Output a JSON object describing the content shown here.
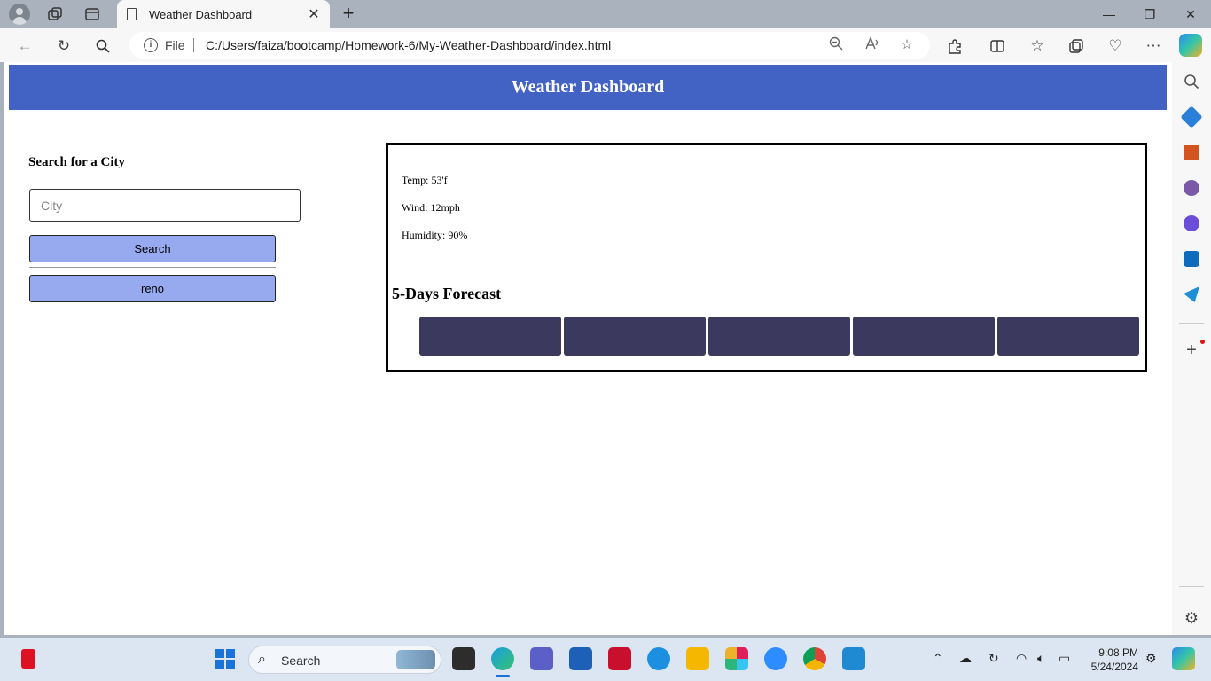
{
  "browser": {
    "tab_title": "Weather Dashboard",
    "tab_close": "✕",
    "new_tab": "+",
    "url_scheme_label": "File",
    "url": "C:/Users/faiza/bootcamp/Homework-6/My-Weather-Dashboard/index.html",
    "window_controls": [
      "—",
      "❐",
      "✕"
    ]
  },
  "page": {
    "title": "Weather Dashboard",
    "search_heading": "Search for a City",
    "city_placeholder": "City",
    "search_button": "Search",
    "history": [
      "reno"
    ],
    "current": {
      "temp": "Temp: 53'f",
      "wind": "Wind: 12mph",
      "humidity": "Humidity: 90%"
    },
    "forecast_title": "5-Days Forecast",
    "forecast_card_count": 5,
    "colors": {
      "header": "#4262c4",
      "button": "#97aaf0",
      "forecast_card": "#3b3a5e"
    }
  },
  "taskbar": {
    "search_label": "Search",
    "time": "9:08 PM",
    "date": "5/24/2024"
  }
}
